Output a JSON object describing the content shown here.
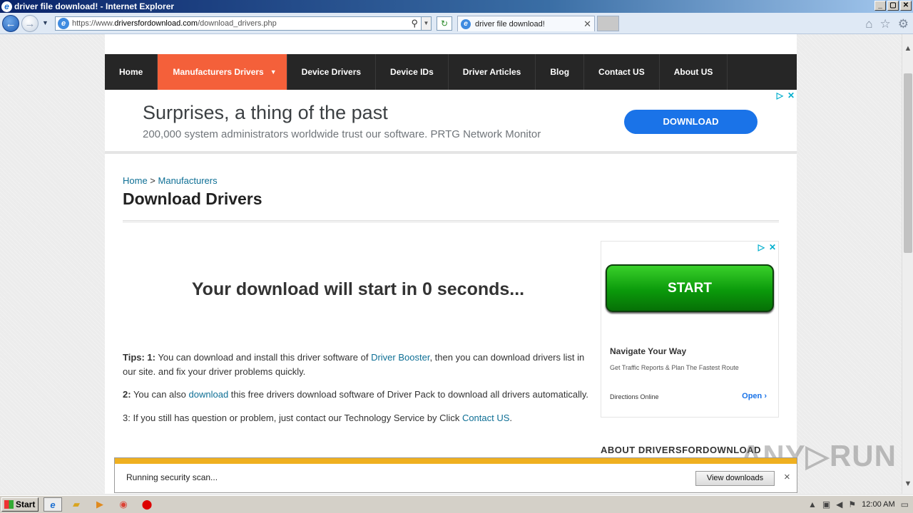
{
  "window": {
    "title": "driver file download! - Internet Explorer",
    "min": "_",
    "max": "▢",
    "close": "✕"
  },
  "addressbar": {
    "url_prefix": "https://www.",
    "url_host": "driversfordownload.com",
    "url_path": "/download_drivers.php"
  },
  "tab": {
    "title": "driver file download!",
    "close": "✕"
  },
  "site_nav": {
    "items": [
      "Home",
      "Manufacturers Drivers",
      "Device Drivers",
      "Device IDs",
      "Driver Articles",
      "Blog",
      "Contact US",
      "About US"
    ]
  },
  "top_ad": {
    "title": "Surprises, a thing of the past",
    "subtitle": "200,000 system administrators worldwide trust our software. PRTG Network Monitor",
    "button": "DOWNLOAD"
  },
  "breadcrumb": {
    "home": "Home",
    "sep": " > ",
    "current": "Manufacturers"
  },
  "page_title": "Download Drivers",
  "countdown": "Your download will start in 0 seconds...",
  "tips": {
    "t1_label": "Tips: 1:",
    "t1_pre": " You can download and install this driver software of ",
    "t1_link": "Driver Booster",
    "t1_post": ", then you can download drivers list in our site. and fix your driver problems quickly.",
    "t2_label": "2:",
    "t2_pre": " You can also ",
    "t2_link": "download",
    "t2_post": " this free drivers download software of Driver Pack to download all drivers automatically.",
    "t3_pre": "3: If you still has question or problem, just contact our Technology Service by Click ",
    "t3_link": "Contact US",
    "t3_post": "."
  },
  "side_ad": {
    "button": "START",
    "title": "Navigate Your Way",
    "subtitle": "Get Traffic Reports & Plan The Fastest Route",
    "advertiser": "Directions Online",
    "open": "Open"
  },
  "about_heading": "ABOUT DRIVERSFORDOWNLOAD",
  "download_bar": {
    "status": "Running security scan...",
    "view_button": "View downloads",
    "close": "×"
  },
  "watermark": "ANY▷RUN",
  "taskbar": {
    "start": "Start",
    "clock": "12:00 AM"
  },
  "colors": {
    "nav_bg": "#262626",
    "nav_active": "#f4603a",
    "link": "#0e6f95",
    "ad_button": "#1a73e8",
    "start_green": "#0b9a0b",
    "progress": "#efb020"
  }
}
